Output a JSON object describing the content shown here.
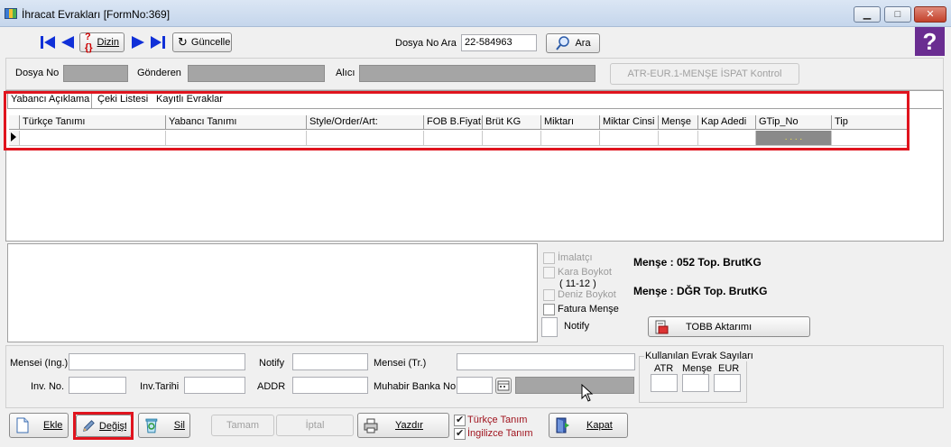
{
  "window": {
    "title": "İhracat Evrakları [FormNo:369]",
    "minimize": "▁",
    "maximize": "□",
    "close": "✕"
  },
  "toolbar": {
    "dizin_label": "Dizin",
    "guncelle_label": "Güncelle",
    "dosya_no_ara_label": "Dosya No Ara",
    "dosya_no_ara_value": "22-584963",
    "ara_label": "Ara",
    "help_glyph": "?"
  },
  "header": {
    "dosya_no_label": "Dosya No",
    "gonderen_label": "Gönderen",
    "alici_label": "Alıcı",
    "atr_button_label": "ATR-EUR.1-MENŞE İSPAT Kontrol"
  },
  "tabs": [
    "Yabancı Açıklama",
    "Çeki Listesi",
    "Kayıtlı Evraklar"
  ],
  "grid": {
    "columns": [
      "Türkçe Tanımı",
      "Yabancı Tanımı",
      "Style/Order/Art:",
      "FOB B.Fiyatı",
      "Brüt KG",
      "Miktarı",
      "Miktar Cinsi",
      "Menşe",
      "Kap Adedi",
      "GTip_No",
      "Tip"
    ],
    "gtip_placeholder": ". . . ."
  },
  "options": {
    "imalatci": "İmalatçı",
    "kara_boykot": "Kara Boykot",
    "kara_boykot_sub": "( 11-12 )",
    "deniz_boykot": "Deniz Boykot",
    "fatura_mense": "Fatura Menşe",
    "notify": "Notify",
    "tobb_button": "TOBB Aktarımı"
  },
  "summary": {
    "line1": "Menşe : 052  Top. BrutKG",
    "line2": "Menşe : DĞR  Top. BrutKG"
  },
  "details": {
    "mensei_ing_label": "Mensei (Ing.)",
    "notify_label": "Notify",
    "mensei_tr_label": "Mensei (Tr.)",
    "inv_no_label": "Inv. No.",
    "inv_tarihi_label": "Inv.Tarihi",
    "addr_label": "ADDR",
    "muhabir_label": "Muhabir Banka No",
    "evrak_group_label": "Kullanılan Evrak Sayıları",
    "atr_label": "ATR",
    "mense_label": "Menşe",
    "eur_label": "EUR"
  },
  "footer": {
    "ekle": "Ekle",
    "degistir": "Değiştir",
    "sil": "Sil",
    "tamam": "Tamam",
    "iptal": "İptal",
    "yazdir": "Yazdır",
    "turkce_tanim": "Türkçe Tanım",
    "ingilizce_tanim": "İngilizce Tanım",
    "kapat": "Kapat"
  },
  "colors": {
    "highlight_red": "#e0141e",
    "nav_blue": "#1030d8",
    "help_purple": "#6a2d91",
    "text_red": "#a0141e"
  }
}
